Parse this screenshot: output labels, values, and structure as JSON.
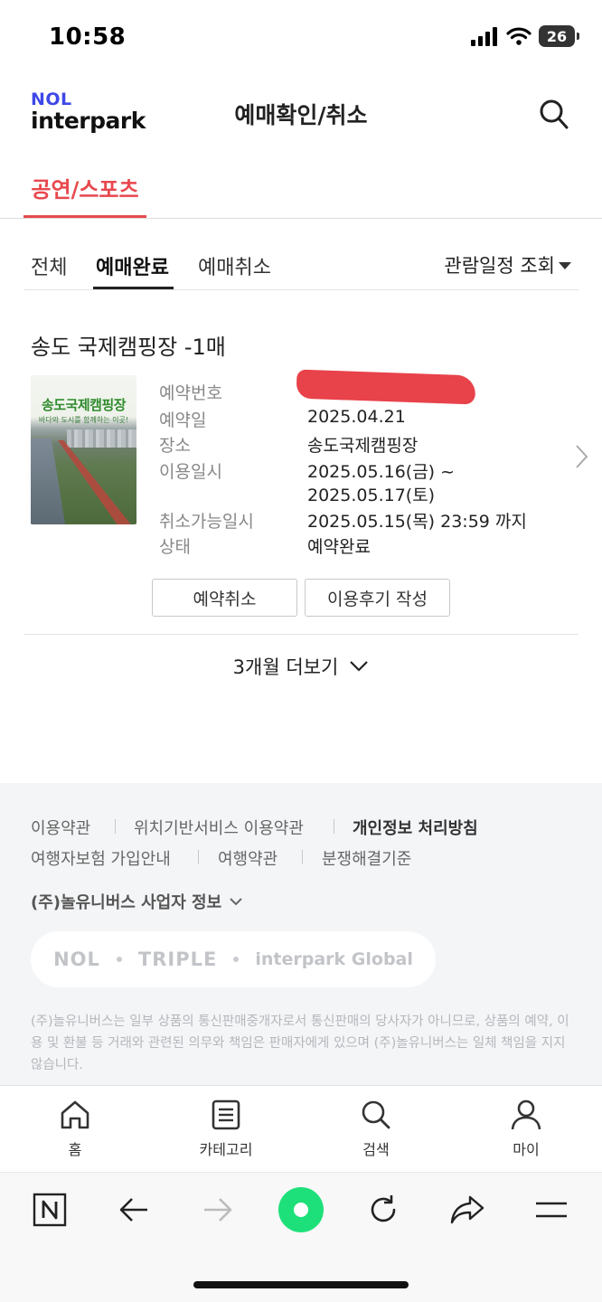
{
  "status_bar": {
    "time": "10:58",
    "battery": "26"
  },
  "header": {
    "logo_top": "NOL",
    "logo_bottom": "interpark",
    "title": "예매확인/취소"
  },
  "top_tabs": [
    {
      "label": "공연/스포츠",
      "active": true
    }
  ],
  "sub_tabs": [
    {
      "label": "전체",
      "active": false
    },
    {
      "label": "예매완료",
      "active": true
    },
    {
      "label": "예매취소",
      "active": false
    }
  ],
  "date_filter": {
    "label": "관람일정 조회"
  },
  "booking": {
    "title": "송도 국제캠핑장 -1매",
    "poster": {
      "title": "송도국제캠핑장",
      "subtitle": "바다와 도시를 함께하는 이곳!"
    },
    "fields": [
      {
        "label": "예약번호",
        "value": "",
        "redacted": true
      },
      {
        "label": "예약일",
        "value": "2025.04.21"
      },
      {
        "label": "장소",
        "value": "송도국제캠핑장"
      },
      {
        "label": "이용일시",
        "value": "2025.05.16(금) ~",
        "value2": "2025.05.17(토)"
      },
      {
        "label": "취소가능일시",
        "value": "2025.05.15(목) 23:59 까지"
      },
      {
        "label": "상태",
        "value": "예약완료"
      }
    ],
    "buttons": {
      "cancel": "예약취소",
      "review": "이용후기 작성"
    }
  },
  "more": {
    "label": "3개월 더보기"
  },
  "footer": {
    "links_row1": [
      "이용약관",
      "위치기반서비스 이용약관",
      "개인정보 처리방침"
    ],
    "links_row2": [
      "여행자보험 가입안내",
      "여행약관",
      "분쟁해결기준"
    ],
    "business_info": "(주)놀유니버스 사업자 정보",
    "family_sites": [
      "NOL",
      "TRIPLE",
      "interpark Global"
    ],
    "disclaimer": "(주)놀유니버스는 일부 상품의 통신판매중개자로서 통신판매의 당사자가 아니므로, 상품의 예약, 이용 및 환불 등 거래와 관련된 의무와 책임은 판매자에게 있으며 (주)놀유니버스는 일체 책임을 지지 않습니다."
  },
  "bottom_nav": [
    {
      "label": "홈",
      "icon": "home-icon"
    },
    {
      "label": "카테고리",
      "icon": "category-icon"
    },
    {
      "label": "검색",
      "icon": "search-icon"
    },
    {
      "label": "마이",
      "icon": "person-icon"
    }
  ],
  "browser_toolbar": [
    "naver-n-icon",
    "back-arrow-icon",
    "forward-arrow-icon",
    "green-dot-icon",
    "reload-icon",
    "share-icon",
    "menu-icon"
  ],
  "colors": {
    "accent": "#e8484e",
    "brand_blue": "#3e48e8",
    "redaction": "#e8424a",
    "green": "#1ee07a"
  }
}
